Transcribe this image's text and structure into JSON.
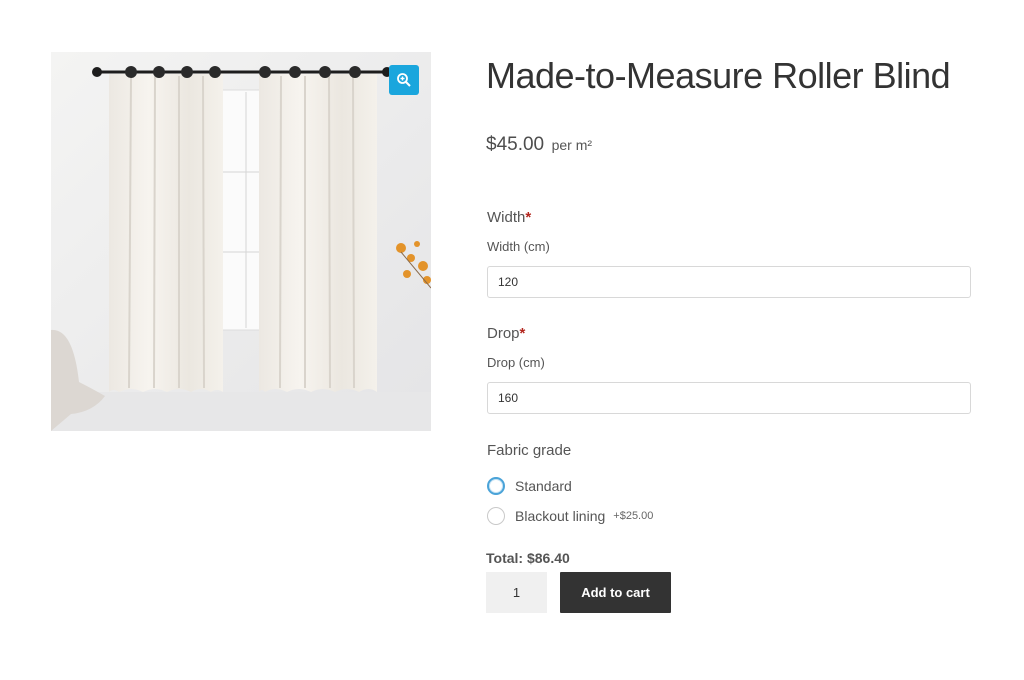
{
  "gallery": {
    "image_alt": "Product photo of cream blackout curtains on a black rod in front of a window",
    "zoom_icon": "magnifier-plus-icon",
    "colors": {
      "zoom_bg": "#1aa6dd"
    }
  },
  "product": {
    "title": "Made-to-Measure Roller Blind",
    "price": "$45.00",
    "price_unit": "per m²"
  },
  "fields": {
    "width": {
      "title": "Width",
      "required_mark": "*",
      "label": "Width (cm)",
      "value": "120"
    },
    "drop": {
      "title": "Drop",
      "required_mark": "*",
      "label": "Drop (cm)",
      "value": "160"
    }
  },
  "fabric_grade": {
    "title": "Fabric grade",
    "options": [
      {
        "label": "Standard",
        "extra": "",
        "selected": true
      },
      {
        "label": "Blackout lining",
        "extra": "+$25.00",
        "selected": false
      }
    ]
  },
  "cart": {
    "total": "Total: $86.40",
    "quantity": "1",
    "add_label": "Add to cart",
    "button_color": "#333333"
  }
}
